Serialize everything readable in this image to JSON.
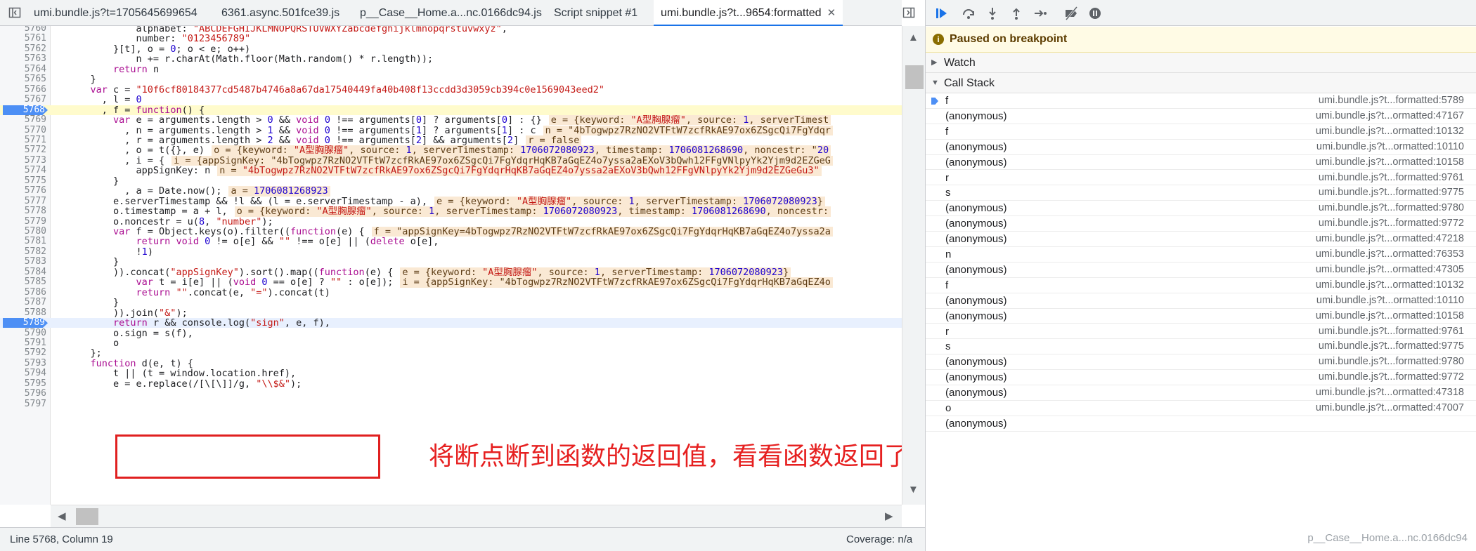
{
  "editor": {
    "tabs": [
      {
        "label": "umi.bundle.js?t=1705645699654"
      },
      {
        "label": "6361.async.501fce39.js"
      },
      {
        "label": "p__Case__Home.a...nc.0166dc94.js"
      },
      {
        "label": "Script snippet #1"
      },
      {
        "label": "umi.bundle.js?t...9654:formatted",
        "active": true
      }
    ],
    "lines": [
      {
        "n": "5760",
        "code": "            alphabet: \"ABCDEFGHIJKLMNOPQRSTUVWXYZabcdefghijklmnopqrstuvwxyz\","
      },
      {
        "n": "5761",
        "code": "            number: \"0123456789\""
      },
      {
        "n": "5762",
        "code": "        }[t], o = 0; o < e; o++)"
      },
      {
        "n": "5763",
        "code": "            n += r.charAt(Math.floor(Math.random() * r.length));"
      },
      {
        "n": "5764",
        "code": "        return n"
      },
      {
        "n": "5765",
        "code": "    }"
      },
      {
        "n": "5766",
        "code": "    var c = \"10f6cf80184377cd5487b4746a8a67da17540449fa40b408f13ccdd3d3059cb394c0e1569043eed2\""
      },
      {
        "n": "5767",
        "code": "      , l = 0"
      },
      {
        "n": "5768",
        "code": "      , f = function() {",
        "bp": true,
        "hl": true
      },
      {
        "n": "5769",
        "code": "        var e = arguments.length > 0 && void 0 !== arguments[0] ? arguments[0] : {}",
        "inline": "e = {keyword: \"A型胸腺瘤\", source: 1, serverTimest"
      },
      {
        "n": "5770",
        "code": "          , n = arguments.length > 1 && void 0 !== arguments[1] ? arguments[1] : c",
        "inline": "n = \"4bTogwpz7RzNO2VTFtW7zcfRkAE97ox6ZSgcQi7FgYdqr"
      },
      {
        "n": "5771",
        "code": "          , r = arguments.length > 2 && void 0 !== arguments[2] && arguments[2]",
        "inline": "r = false"
      },
      {
        "n": "5772",
        "code": "          , o = t({}, e)",
        "inline": "o = {keyword: \"A型胸腺瘤\", source: 1, serverTimestamp: 1706072080923, timestamp: 1706081268690, noncestr: \"20"
      },
      {
        "n": "5773",
        "code": "          , i = {",
        "inline": "i = {appSignKey: \"4bTogwpz7RzNO2VTFtW7zcfRkAE97ox6ZSgcQi7FgYdqrHqKB7aGqEZ4o7yssa2aEXoV3bQwh12FFgVNlpyYk2Yjm9d2EZGeG"
      },
      {
        "n": "5774",
        "code": "            appSignKey: n",
        "inline": "n = \"4bTogwpz7RzNO2VTFtW7zcfRkAE97ox6ZSgcQi7FgYdqrHqKB7aGqEZ4o7yssa2aEXoV3bQwh12FFgVNlpyYk2Yjm9d2EZGeGu3\""
      },
      {
        "n": "5775",
        "code": "        }"
      },
      {
        "n": "5776",
        "code": "          , a = Date.now();",
        "inline": "a = 1706081268923"
      },
      {
        "n": "5777",
        "code": "        e.serverTimestamp && !l && (l = e.serverTimestamp - a),",
        "inline": "e = {keyword: \"A型胸腺瘤\", source: 1, serverTimestamp: 1706072080923}"
      },
      {
        "n": "5778",
        "code": "        o.timestamp = a + l,",
        "inline": "o = {keyword: \"A型胸腺瘤\", source: 1, serverTimestamp: 1706072080923, timestamp: 1706081268690, noncestr:"
      },
      {
        "n": "5779",
        "code": "        o.noncestr = u(8, \"number\");"
      },
      {
        "n": "5780",
        "code": "        var f = Object.keys(o).filter((function(e) {",
        "inline": "f = \"appSignKey=4bTogwpz7RzNO2VTFtW7zcfRkAE97ox6ZSgcQi7FgYdqrHqKB7aGqEZ4o7yssa2a"
      },
      {
        "n": "5781",
        "code": "            return void 0 != o[e] && \"\" !== o[e] || (delete o[e],"
      },
      {
        "n": "5782",
        "code": "            !1)"
      },
      {
        "n": "5783",
        "code": "        }"
      },
      {
        "n": "5784",
        "code": "        )).concat(\"appSignKey\").sort().map((function(e) {",
        "inline": "e = {keyword: \"A型胸腺瘤\", source: 1, serverTimestamp: 1706072080923}"
      },
      {
        "n": "5785",
        "code": "            var t = i[e] || (void 0 == o[e] ? \"\" : o[e]);",
        "inline": "i = {appSignKey: \"4bTogwpz7RzNO2VTFtW7zcfRkAE97ox6ZSgcQi7FgYdqrHqKB7aGqEZ4o"
      },
      {
        "n": "5786",
        "code": "            return \"\".concat(e, \"=\").concat(t)"
      },
      {
        "n": "5787",
        "code": "        }"
      },
      {
        "n": "5788",
        "code": "        )).join(\"&\");"
      },
      {
        "n": "5789",
        "code": "        return r && console.log(\"sign\", e, f),",
        "bp": true,
        "cur": true
      },
      {
        "n": "5790",
        "code": "        o.sign = s(f),"
      },
      {
        "n": "5791",
        "code": "        o"
      },
      {
        "n": "5792",
        "code": "    };"
      },
      {
        "n": "5793",
        "code": "    function d(e, t) {"
      },
      {
        "n": "5794",
        "code": "        t || (t = window.location.href),"
      },
      {
        "n": "5795",
        "code": "        e = e.replace(/[\\[\\]]/g, \"\\\\$&\");"
      },
      {
        "n": "5796",
        "code": ""
      },
      {
        "n": "5797",
        "code": ""
      }
    ],
    "annotation": "将断点断到函数的返回值，看看函数返回了什么",
    "status": {
      "position": "Line 5768, Column 19",
      "coverage": "Coverage: n/a"
    }
  },
  "debugger": {
    "paused_label": "Paused on breakpoint",
    "watch_label": "Watch",
    "callstack_label": "Call Stack",
    "frames": [
      {
        "fn": "f",
        "loc": "umi.bundle.js?t...formatted:5789",
        "selected": true
      },
      {
        "fn": "(anonymous)",
        "loc": "umi.bundle.js?t...ormatted:47167"
      },
      {
        "fn": "f",
        "loc": "umi.bundle.js?t...ormatted:10132"
      },
      {
        "fn": "(anonymous)",
        "loc": "umi.bundle.js?t...ormatted:10110"
      },
      {
        "fn": "(anonymous)",
        "loc": "umi.bundle.js?t...ormatted:10158"
      },
      {
        "fn": "r",
        "loc": "umi.bundle.js?t...formatted:9761"
      },
      {
        "fn": "s",
        "loc": "umi.bundle.js?t...formatted:9775"
      },
      {
        "fn": "(anonymous)",
        "loc": "umi.bundle.js?t...formatted:9780"
      },
      {
        "fn": "(anonymous)",
        "loc": "umi.bundle.js?t...formatted:9772"
      },
      {
        "fn": "(anonymous)",
        "loc": "umi.bundle.js?t...ormatted:47218"
      },
      {
        "fn": "n",
        "loc": "umi.bundle.js?t...ormatted:76353"
      },
      {
        "fn": "(anonymous)",
        "loc": "umi.bundle.js?t...ormatted:47305"
      },
      {
        "fn": "f",
        "loc": "umi.bundle.js?t...ormatted:10132"
      },
      {
        "fn": "(anonymous)",
        "loc": "umi.bundle.js?t...ormatted:10110"
      },
      {
        "fn": "(anonymous)",
        "loc": "umi.bundle.js?t...ormatted:10158"
      },
      {
        "fn": "r",
        "loc": "umi.bundle.js?t...formatted:9761"
      },
      {
        "fn": "s",
        "loc": "umi.bundle.js?t...formatted:9775"
      },
      {
        "fn": "(anonymous)",
        "loc": "umi.bundle.js?t...formatted:9780"
      },
      {
        "fn": "(anonymous)",
        "loc": "umi.bundle.js?t...formatted:9772"
      },
      {
        "fn": "(anonymous)",
        "loc": "umi.bundle.js?t...ormatted:47318"
      },
      {
        "fn": "o",
        "loc": "umi.bundle.js?t...ormatted:47007"
      },
      {
        "fn": "(anonymous)",
        "loc": ""
      }
    ],
    "watermark": "p__Case__Home.a...nc.0166dc94"
  }
}
